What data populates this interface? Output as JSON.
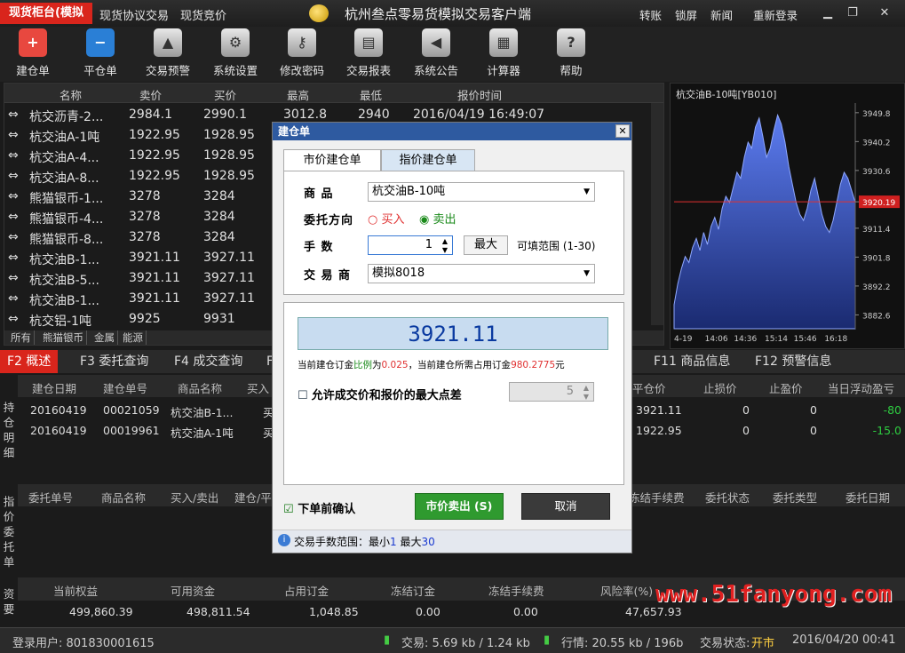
{
  "titlebar": {
    "app_tab": "现货柜台(模拟",
    "nav1": "现货协议交易",
    "nav2": "现货竞价",
    "title": "杭州叁点零易货模拟交易客户端",
    "transfer": "转账",
    "lock": "锁屏",
    "news": "新闻",
    "relogin": "重新登录"
  },
  "toolbar": [
    {
      "label": "建仓单",
      "icon": "+",
      "color": "#e8483f"
    },
    {
      "label": "平仓单",
      "icon": "−",
      "color": "#2a7fd6"
    },
    {
      "label": "交易预警",
      "icon": "▲",
      "color": ""
    },
    {
      "label": "系统设置",
      "icon": "⚙",
      "color": ""
    },
    {
      "label": "修改密码",
      "icon": "⚷",
      "color": ""
    },
    {
      "label": "交易报表",
      "icon": "▤",
      "color": ""
    },
    {
      "label": "系统公告",
      "icon": "◀",
      "color": ""
    },
    {
      "label": "计算器",
      "icon": "▦",
      "color": ""
    },
    {
      "label": "帮助",
      "icon": "?",
      "color": ""
    }
  ],
  "quotes": {
    "headers": [
      "名称",
      "卖价",
      "买价",
      "最高",
      "最低",
      "报价时间"
    ],
    "rows": [
      [
        "杭交沥青-2...",
        "2984.1",
        "2990.1",
        "3012.8",
        "2940",
        "2016/04/19 16:49:07"
      ],
      [
        "杭交油A-1吨",
        "1922.95",
        "1928.95"
      ],
      [
        "杭交油A-4...",
        "1922.95",
        "1928.95"
      ],
      [
        "杭交油A-8...",
        "1922.95",
        "1928.95"
      ],
      [
        "熊猫银币-1...",
        "3278",
        "3284"
      ],
      [
        "熊猫银币-4...",
        "3278",
        "3284"
      ],
      [
        "熊猫银币-8...",
        "3278",
        "3284"
      ],
      [
        "杭交油B-1...",
        "3921.11",
        "3927.11"
      ],
      [
        "杭交油B-5...",
        "3921.11",
        "3927.11"
      ],
      [
        "杭交油B-1...",
        "3921.11",
        "3927.11"
      ],
      [
        "杭交铝-1吨",
        "9925",
        "9931"
      ]
    ],
    "tabs": [
      "所有",
      "熊猫银币",
      "金属",
      "能源"
    ]
  },
  "chart_data": {
    "type": "area",
    "title": "杭交油B-10吨[YB010]",
    "x_ticks": [
      "4-19",
      "14:06",
      "14:36",
      "15:14",
      "15:46",
      "16:18"
    ],
    "y_ticks": [
      3949.8,
      3940.2,
      3930.6,
      3920.19,
      3911.4,
      3901.8,
      3892.2,
      3882.6
    ],
    "highlight": 3920.19,
    "ylim": [
      3878,
      3953
    ],
    "values": [
      3886,
      3893,
      3898,
      3902,
      3900,
      3905,
      3908,
      3904,
      3910,
      3906,
      3912,
      3915,
      3911,
      3918,
      3922,
      3920,
      3925,
      3930,
      3928,
      3935,
      3940,
      3938,
      3945,
      3948,
      3942,
      3935,
      3938,
      3944,
      3949,
      3946,
      3940,
      3932,
      3926,
      3920,
      3916,
      3914,
      3918,
      3924,
      3928,
      3922,
      3916,
      3912,
      3910,
      3914,
      3920,
      3926,
      3930,
      3928,
      3924,
      3920
    ]
  },
  "ftabs": [
    "F2 概述",
    "F3 委托查询",
    "F4 成交查询",
    "F",
    "F11 商品信息",
    "F12 预警信息"
  ],
  "positions": {
    "side": "持仓明细",
    "headers": [
      "建仓日期",
      "建仓单号",
      "商品名称",
      "买入",
      "平仓价",
      "止损价",
      "止盈价",
      "当日浮动盈亏"
    ],
    "rows": [
      [
        "20160419",
        "00021059",
        "杭交油B-1...",
        "买",
        "3921.11",
        "0",
        "0",
        "-80"
      ],
      [
        "20160419",
        "00019961",
        "杭交油A-1吨",
        "买",
        "1922.95",
        "0",
        "0",
        "-15.0"
      ]
    ]
  },
  "orders": {
    "side": "指价委托单",
    "headers": [
      "委托单号",
      "商品名称",
      "买入/卖出",
      "建仓/平",
      "冻结手续费",
      "委托状态",
      "委托类型",
      "委托日期"
    ]
  },
  "account": {
    "side": "资要",
    "headers": [
      "当前权益",
      "可用资金",
      "占用订金",
      "冻结订金",
      "冻结手续费",
      "风险率(%)"
    ],
    "values": [
      "499,860.39",
      "498,811.54",
      "1,048.85",
      "0.00",
      "0.00",
      "47,657.93"
    ]
  },
  "watermark": "www.51fanyong.com",
  "status": {
    "user": "登录用户: 801830001615",
    "trade": "交易: 5.69 kb / 1.24 kb",
    "quote": "行情: 20.55 kb / 196b",
    "state_label": "交易状态:",
    "state": "开市",
    "datetime": "2016/04/20 00:41"
  },
  "dialog": {
    "title": "建仓单",
    "tab_market": "市价建仓单",
    "tab_limit": "指价建仓单",
    "goods_label": "商  品",
    "goods": "杭交油B-10吨",
    "dir_label": "委托方向",
    "buy": "买入",
    "sell": "卖出",
    "qty_label": "手  数",
    "qty": "1",
    "max_btn": "最大",
    "range": "可填范围 (1-30)",
    "broker_label": "交 易 商",
    "broker": "模拟8018",
    "price": "3921.11",
    "margin_a": "当前建仓订金",
    "margin_b": "比例",
    "margin_c": "为",
    "ratio": "0.025",
    "margin_d": "，当前建仓所需占用订金",
    "margin_amount": "980.2775",
    "margin_e": "元",
    "allow_label": "允许成交价和报价的最大点差",
    "allow_value": "5",
    "confirm_label": "下单前确认",
    "sell_btn": "市价卖出 (S)",
    "cancel_btn": "取消",
    "footer_label": "交易手数范围：最小",
    "min": "1",
    "footer_mid": " 最大",
    "max": "30"
  }
}
